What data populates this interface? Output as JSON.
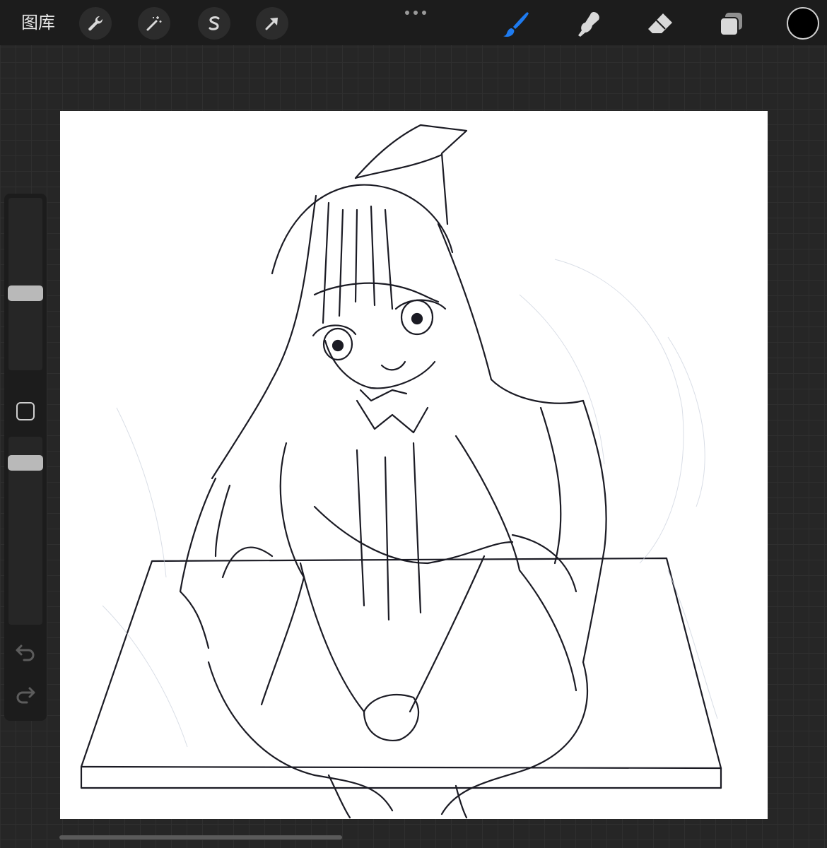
{
  "toolbar": {
    "gallery_label": "图库",
    "left_tools": [
      "wrench-icon",
      "magic-wand-icon",
      "selection-icon",
      "transform-arrow-icon"
    ],
    "right_tools": [
      "brush-icon",
      "smudge-icon",
      "eraser-icon",
      "layers-icon"
    ],
    "active_tool": "brush-icon",
    "active_color": "#000000",
    "accent_color": "#1e7bf0"
  }
}
